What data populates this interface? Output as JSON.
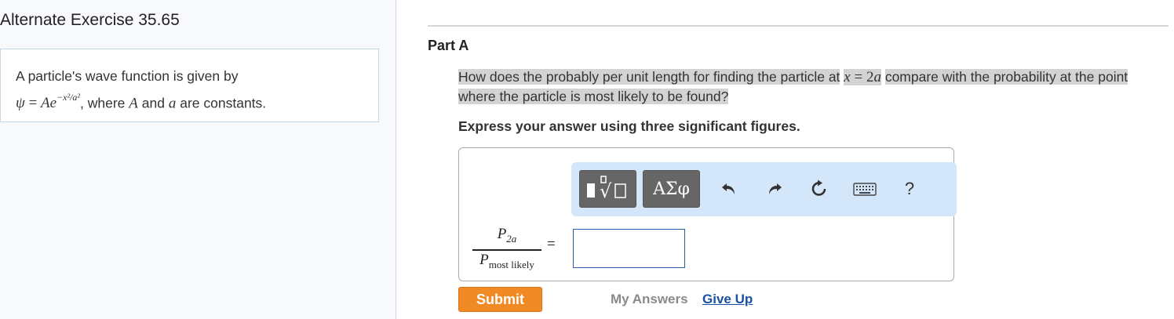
{
  "exercise": {
    "title": "Alternate Exercise 35.65",
    "intro_line1": "A particle's wave function is given by",
    "intro_after_math": ", where",
    "intro_and": "and",
    "intro_end": "are constants.",
    "var_A": "A",
    "var_a": "a"
  },
  "part": {
    "label": "Part A",
    "question_before": "How does the probably per unit length for finding the particle at",
    "question_math": "x = 2a",
    "question_after": "compare with the probability at the point where the particle is most likely to be found?",
    "instruction": "Express your answer using three significant figures."
  },
  "toolbar": {
    "templates_symbol": "√",
    "symbols_label": "ΑΣφ",
    "help_label": "?",
    "icons": [
      "templates-icon",
      "undo-icon",
      "redo-icon",
      "reset-icon",
      "keyboard-icon",
      "help-icon"
    ]
  },
  "answer": {
    "numerator_var": "P",
    "numerator_sub": "2a",
    "denominator_var": "P",
    "denominator_sub": "most likely",
    "equals": "=",
    "value": ""
  },
  "actions": {
    "submit_label": "Submit",
    "my_answers_label": "My Answers",
    "give_up_label": "Give Up"
  },
  "colors": {
    "submit": "#f08a24",
    "toolbar_bg": "#d3e6fa",
    "toolbar_button": "#666666",
    "link": "#1a4fa3",
    "input_border": "#2a5fa9"
  }
}
